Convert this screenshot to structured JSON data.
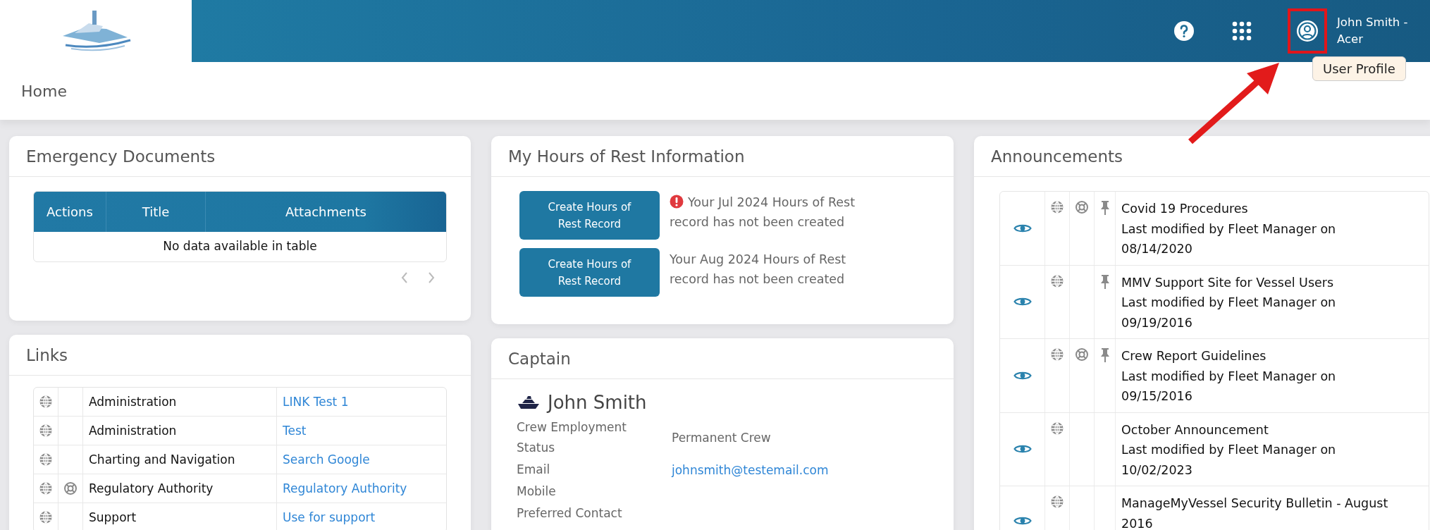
{
  "header": {
    "profile": {
      "highlighted": true,
      "user_name": "John Smith - Acer",
      "tooltip": "User Profile"
    }
  },
  "breadcrumb": "Home",
  "emergency_documents": {
    "title": "Emergency Documents",
    "columns": [
      "Actions",
      "Title",
      "Attachments"
    ],
    "empty_message": "No data available in table"
  },
  "links": {
    "title": "Links",
    "rows": [
      {
        "category": "Administration",
        "link": "LINK Test 1",
        "lifebuoy": false
      },
      {
        "category": "Administration",
        "link": "Test",
        "lifebuoy": false
      },
      {
        "category": "Charting and Navigation",
        "link": "Search Google",
        "lifebuoy": false
      },
      {
        "category": "Regulatory Authority",
        "link": "Regulatory Authority",
        "lifebuoy": true
      },
      {
        "category": "Support",
        "link": "Use for support",
        "lifebuoy": false
      }
    ]
  },
  "hours_of_rest": {
    "title": "My Hours of Rest Information",
    "records": [
      {
        "button": "Create Hours of Rest Record",
        "message": "Your Jul 2024 Hours of Rest record has not been created",
        "warning": true
      },
      {
        "button": "Create Hours of Rest Record",
        "message": "Your Aug 2024 Hours of Rest record has not been created",
        "warning": false
      }
    ]
  },
  "captain": {
    "title": "Captain",
    "name": "John Smith",
    "fields": [
      {
        "label": "Crew Employment Status",
        "value": "Permanent Crew",
        "kind": "text"
      },
      {
        "label": "Email",
        "value": "johnsmith@testemail.com",
        "kind": "email"
      },
      {
        "label": "Mobile"
      },
      {
        "label": "Preferred Contact"
      }
    ]
  },
  "announcements": {
    "title": "Announcements",
    "items": [
      {
        "title": "Covid 19 Procedures",
        "modified": "Last modified by Fleet Manager on 08/14/2020",
        "globe": true,
        "lifebuoy": true,
        "pinned": true
      },
      {
        "title": "MMV Support Site for Vessel Users",
        "modified": "Last modified by Fleet Manager on 09/19/2016",
        "globe": true,
        "lifebuoy": false,
        "pinned": true
      },
      {
        "title": "Crew Report Guidelines",
        "modified": "Last modified by Fleet Manager on 09/15/2016",
        "globe": true,
        "lifebuoy": true,
        "pinned": true
      },
      {
        "title": "October Announcement",
        "modified": "Last modified by Fleet Manager on 10/02/2023",
        "globe": true,
        "lifebuoy": false,
        "pinned": false
      },
      {
        "title": "ManageMyVessel Security Bulletin - August 2016",
        "globe": true,
        "lifebuoy": false,
        "pinned": false
      }
    ]
  }
}
